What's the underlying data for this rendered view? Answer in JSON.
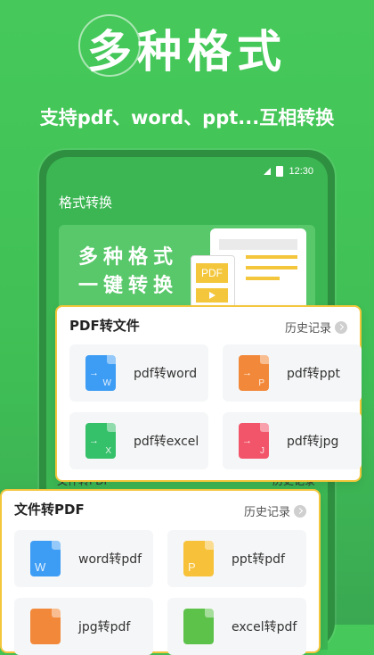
{
  "hero": {
    "title": "多种格式",
    "subtitle": "支持pdf、word、ppt...互相转换"
  },
  "phone": {
    "status_time": "12:30",
    "app_title": "格式转换",
    "banner_line1": "多种格式",
    "banner_line2": "一键转换",
    "banner_pdf_tag": "PDF"
  },
  "pdf_card": {
    "title": "PDF转文件",
    "history": "历史记录",
    "items": [
      {
        "label": "pdf转word",
        "icon": "word-file-icon",
        "color": "#3d9df5",
        "letter": "W"
      },
      {
        "label": "pdf转ppt",
        "icon": "ppt-file-icon",
        "color": "#f2893a",
        "letter": "P"
      },
      {
        "label": "pdf转excel",
        "icon": "excel-file-icon",
        "color": "#35c06a",
        "letter": "X"
      },
      {
        "label": "pdf转jpg",
        "icon": "jpg-file-icon",
        "color": "#f2556a",
        "letter": "J"
      }
    ]
  },
  "ghost": {
    "left": "文件转PDF",
    "right": "历史记录"
  },
  "file_card": {
    "title": "文件转PDF",
    "history": "历史记录",
    "items": [
      {
        "label": "word转pdf",
        "icon": "word-file-icon",
        "color": "#3d9df5",
        "letter": "W"
      },
      {
        "label": "ppt转pdf",
        "icon": "ppt-file-icon",
        "color": "#f7c23a",
        "letter": "P"
      },
      {
        "label": "jpg转pdf",
        "icon": "jpg-file-icon",
        "color": "#f2893a",
        "letter": ""
      },
      {
        "label": "excel转pdf",
        "icon": "excel-file-icon",
        "color": "#5cc24a",
        "letter": ""
      }
    ]
  },
  "colors": {
    "brand_green": "#46c95a",
    "accent_yellow": "#f3c63b"
  }
}
